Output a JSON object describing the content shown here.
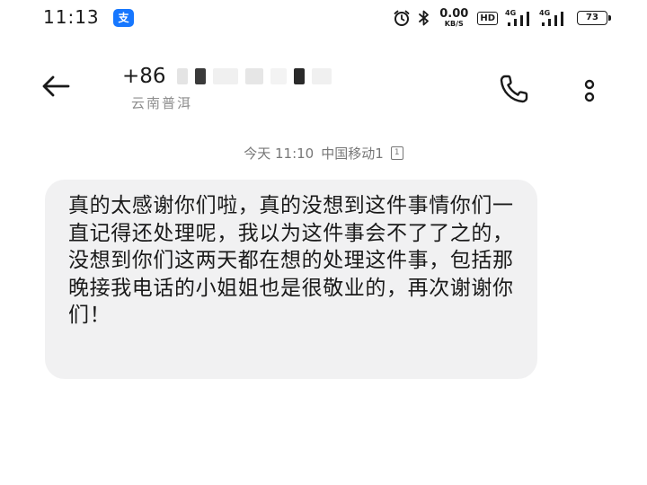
{
  "status_bar": {
    "time": "11:13",
    "app_notification_glyph": "支",
    "net_speed_value": "0.00",
    "net_speed_unit": "KB/S",
    "hd_label": "HD",
    "sim1_network": "4G",
    "sim2_network": "4G",
    "battery_level": "73",
    "icons": [
      "alarm-icon",
      "bluetooth-icon",
      "hd-voice-icon",
      "signal-icon",
      "battery-icon"
    ],
    "accent_color": "#1677ff"
  },
  "header": {
    "contact_prefix": "+86",
    "contact_region": "云南普洱",
    "icons": [
      "back-arrow-icon",
      "phone-icon",
      "more-vertical-icon"
    ]
  },
  "conversation": {
    "timestamp": "今天 11:10",
    "carrier": "中国移动1",
    "sim_slot": "1",
    "messages": [
      {
        "direction": "incoming",
        "text": "真的太感谢你们啦，真的没想到这件事情你们一直记得还处理呢，我以为这件事会不了了之的，没想到你们这两天都在想的处理这件事，包括那晚接我电话的小姐姐也是很敬业的，再次谢谢你们！",
        "bubble_color": "#f1f1f2"
      }
    ]
  }
}
